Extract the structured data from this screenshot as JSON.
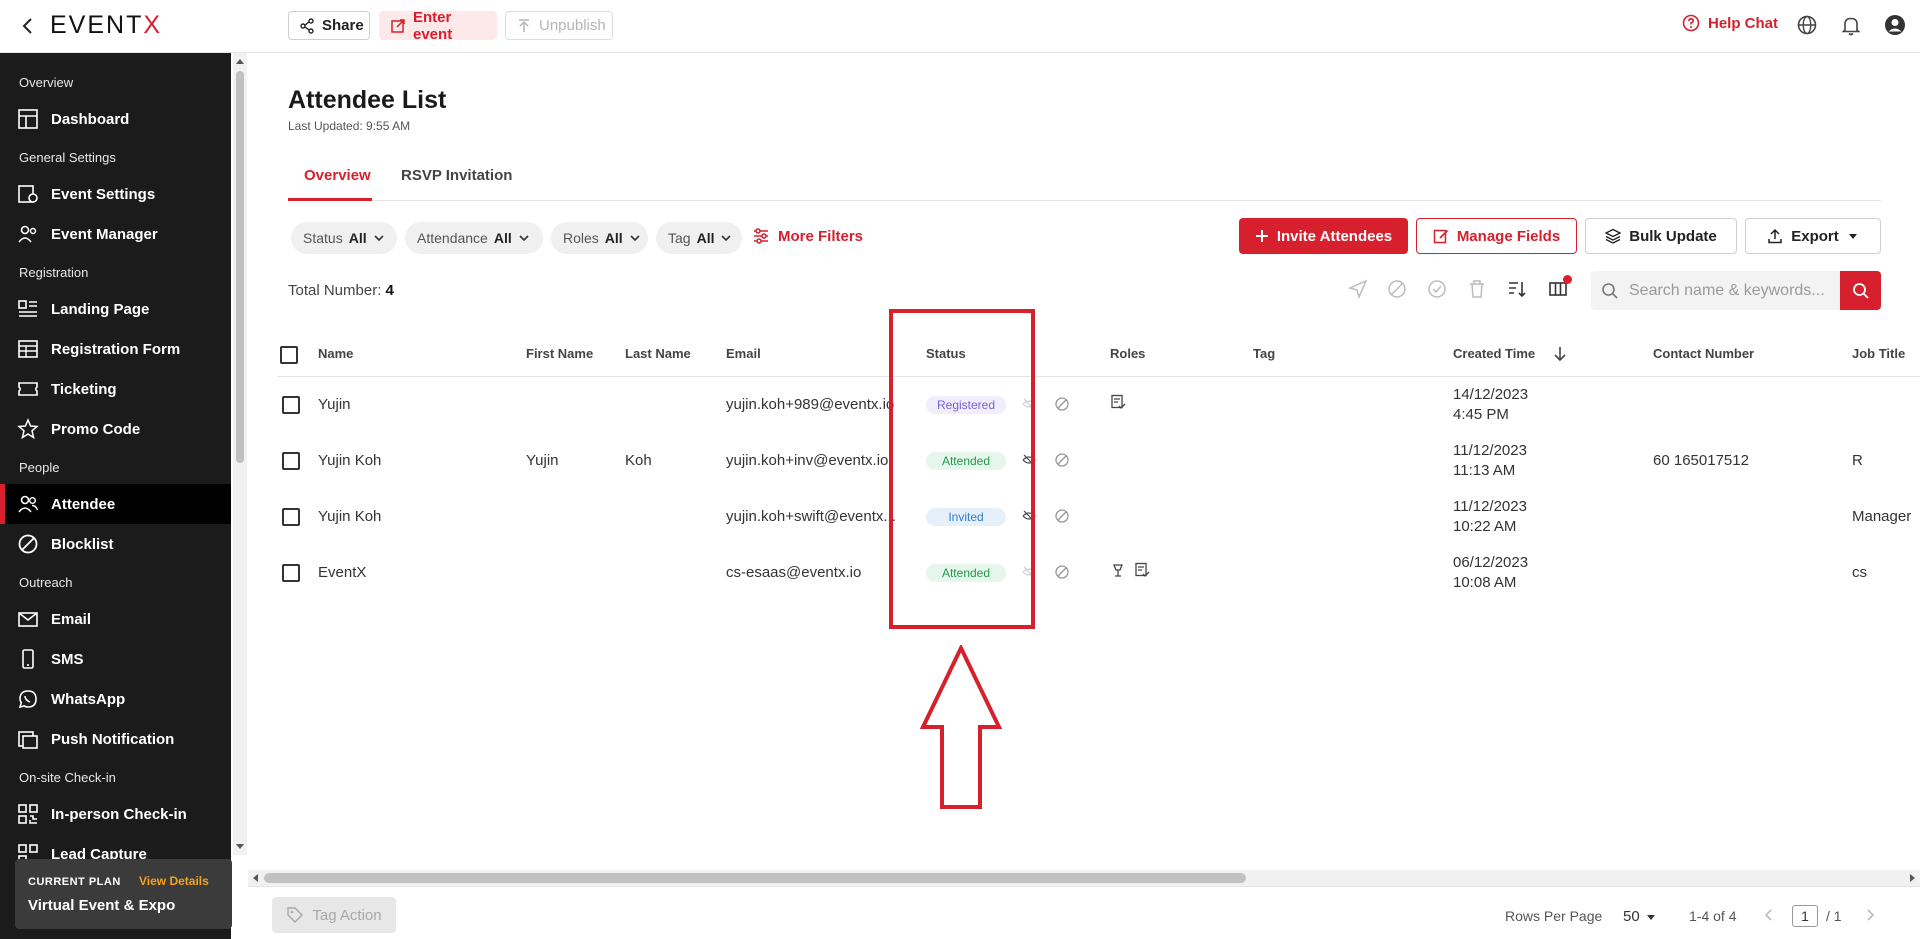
{
  "topbar": {
    "logo_main": "EVENT",
    "logo_accent": "X",
    "share_label": "Share",
    "enter_event_label": "Enter event",
    "unpublish_label": "Unpublish",
    "help_chat_label": "Help Chat"
  },
  "sidebar": {
    "sections": {
      "overview": "Overview",
      "general": "General Settings",
      "registration": "Registration",
      "people": "People",
      "outreach": "Outreach",
      "onsite": "On-site Check-in"
    },
    "items": {
      "dashboard": "Dashboard",
      "event_settings": "Event Settings",
      "event_manager": "Event Manager",
      "landing_page": "Landing Page",
      "registration_form": "Registration Form",
      "ticketing": "Ticketing",
      "promo_code": "Promo Code",
      "attendee": "Attendee",
      "blocklist": "Blocklist",
      "email": "Email",
      "sms": "SMS",
      "whatsapp": "WhatsApp",
      "push_notification": "Push Notification",
      "inperson_checkin": "In-person Check-in",
      "lead_capture": "Lead Capture"
    },
    "plan": {
      "label": "CURRENT PLAN",
      "link": "View Details",
      "name": "Virtual Event & Expo"
    }
  },
  "main": {
    "title": "Attendee List",
    "last_updated": "Last Updated: 9:55 AM",
    "tabs": [
      "Overview",
      "RSVP Invitation"
    ],
    "filters": [
      {
        "label": "Status",
        "value": "All"
      },
      {
        "label": "Attendance",
        "value": "All"
      },
      {
        "label": "Roles",
        "value": "All"
      },
      {
        "label": "Tag",
        "value": "All"
      }
    ],
    "more_filters": "More Filters",
    "actions": {
      "invite": "Invite Attendees",
      "manage": "Manage Fields",
      "bulk": "Bulk Update",
      "export": "Export"
    },
    "total_label": "Total Number:",
    "total_value": "4",
    "search_placeholder": "Search name & keywords..."
  },
  "table": {
    "columns": [
      "Name",
      "First Name",
      "Last Name",
      "Email",
      "Status",
      "Roles",
      "Tag",
      "Created Time",
      "Contact Number",
      "Job Title"
    ],
    "rows": [
      {
        "name": "Yujin",
        "first": "",
        "last": "",
        "email": "yujin.koh+989@eventx.io",
        "status": "Registered",
        "date": "14/12/2023",
        "time": "4:45 PM",
        "contact": "",
        "job": ""
      },
      {
        "name": "Yujin Koh",
        "first": "Yujin",
        "last": "Koh",
        "email": "yujin.koh+inv@eventx.io",
        "status": "Attended",
        "date": "11/12/2023",
        "time": "11:13 AM",
        "contact": "60 165017512",
        "job": "R"
      },
      {
        "name": "Yujin Koh",
        "first": "",
        "last": "",
        "email": "yujin.koh+swift@eventx...",
        "status": "Invited",
        "date": "11/12/2023",
        "time": "10:22 AM",
        "contact": "",
        "job": "Manager"
      },
      {
        "name": "EventX",
        "first": "",
        "last": "",
        "email": "cs-esaas@eventx.io",
        "status": "Attended",
        "date": "06/12/2023",
        "time": "10:08 AM",
        "contact": "",
        "job": "cs"
      }
    ]
  },
  "footer": {
    "tag_action": "Tag Action",
    "rows_per_page_label": "Rows Per Page",
    "rows_per_page_value": "50",
    "range": "1-4 of 4",
    "current_page": "1",
    "total_pages": "/ 1"
  },
  "colors": {
    "accent": "#d6202e",
    "sidebar_bg": "#1b1b1b",
    "registered": "#7b61d9",
    "attended": "#1f9a4a",
    "invited": "#2f7dd3"
  }
}
